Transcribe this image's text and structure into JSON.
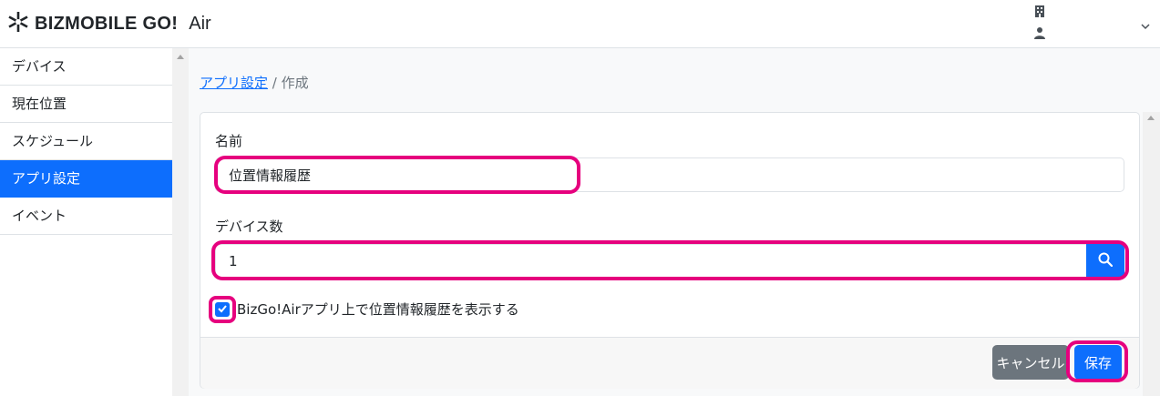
{
  "app": {
    "logo_text": "BIZMOBILE GO!",
    "subtitle": "Air"
  },
  "sidebar": {
    "items": [
      {
        "label": "デバイス"
      },
      {
        "label": "現在位置"
      },
      {
        "label": "スケジュール"
      },
      {
        "label": "アプリ設定",
        "active": true
      },
      {
        "label": "イベント"
      }
    ]
  },
  "breadcrumb": {
    "link": "アプリ設定",
    "separator": " / ",
    "current": "作成"
  },
  "form": {
    "name_label": "名前",
    "name_value": "位置情報履歴",
    "device_count_label": "デバイス数",
    "device_count_value": "1",
    "checkbox_label": "BizGo!Airアプリ上で位置情報履歴を表示する",
    "checkbox_checked": true
  },
  "footer": {
    "cancel_label": "キャンセル",
    "save_label": "保存"
  },
  "icons": {
    "logo": "asterisk-logo-icon",
    "org": "building-icon",
    "user": "user-icon",
    "dropdown": "chevron-down-icon",
    "search": "search-icon",
    "check": "check-icon"
  },
  "colors": {
    "primary": "#0d6efd",
    "secondary": "#6c757d",
    "highlight": "#e6007e"
  }
}
